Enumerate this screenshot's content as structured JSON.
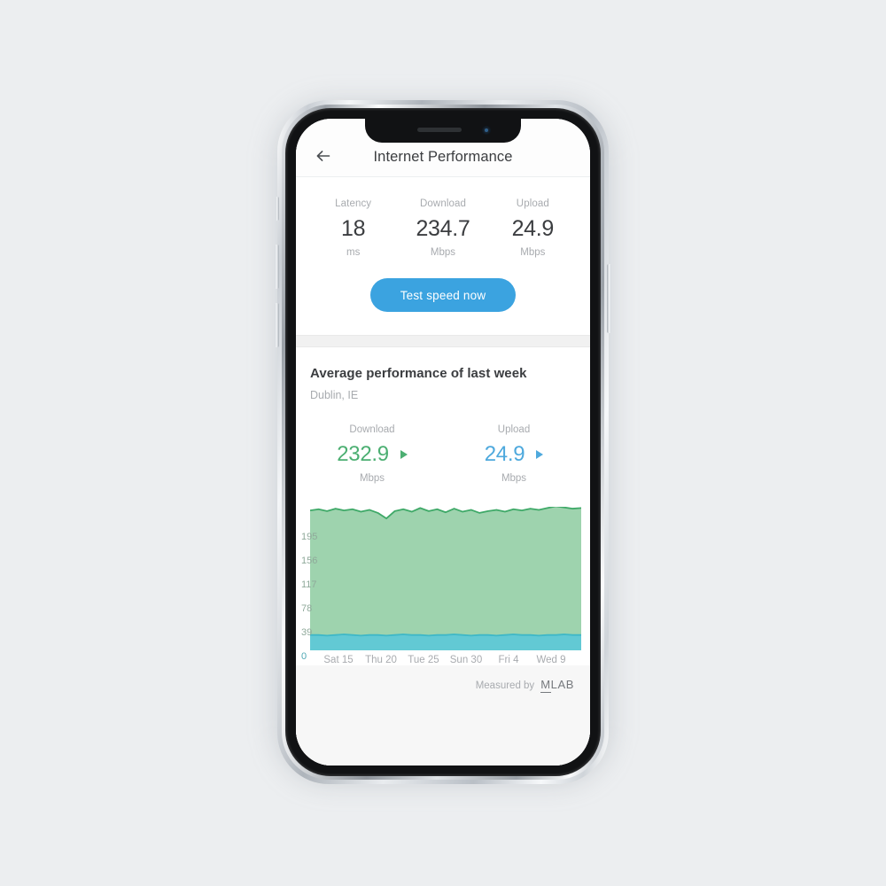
{
  "app": {
    "appbar": {
      "back_icon": "arrow-left-icon",
      "title": "Internet Performance"
    },
    "current_stats": [
      {
        "label": "Latency",
        "value": "18",
        "unit": "ms"
      },
      {
        "label": "Download",
        "value": "234.7",
        "unit": "Mbps"
      },
      {
        "label": "Upload",
        "value": "24.9",
        "unit": "Mbps"
      }
    ],
    "test_button": {
      "label": "Test speed now"
    },
    "average_section": {
      "title": "Average performance of last week",
      "location": "Dublin, IE",
      "stats": [
        {
          "label": "Download",
          "value": "232.9",
          "unit": "Mbps",
          "indicator": "triangle-right-icon",
          "color": "#4caf72"
        },
        {
          "label": "Upload",
          "value": "24.9",
          "unit": "Mbps",
          "indicator": "triangle-right-icon",
          "color": "#4ea9dd"
        }
      ]
    },
    "footer": {
      "measured_by": "Measured by",
      "provider_m": "M",
      "provider_rest": "LAB"
    }
  },
  "colors": {
    "accent_blue": "#3ba3e0",
    "download_green": "#4caf72",
    "upload_blue": "#4ea9dd",
    "area_green_fill": "#9ed3ae",
    "area_blue_fill": "#62c9d4",
    "text_dark": "#3b3d40",
    "text_muted": "#a8abaf"
  },
  "chart_data": {
    "type": "area",
    "title": "",
    "xlabel": "",
    "ylabel": "",
    "ylim": [
      0,
      234
    ],
    "yticks": [
      0,
      39,
      78,
      117,
      156,
      195
    ],
    "ytick_labels": [
      "0",
      "39",
      "78",
      "117",
      "156",
      "195"
    ],
    "grid": true,
    "legend": null,
    "categories": [
      "Sat 15",
      "Thu 20",
      "Tue 25",
      "Sun 30",
      "Fri 4",
      "Wed 9"
    ],
    "xtick_labels": [
      "Sat 15",
      "Thu 20",
      "Tue 25",
      "Sun 30",
      "Fri 4",
      "Wed 9"
    ],
    "series": [
      {
        "name": "Download",
        "color": "#3fa968",
        "fill": "#9ed3ae",
        "unit": "Mbps",
        "values": [
          228,
          230,
          227,
          231,
          228,
          230,
          226,
          229,
          224,
          215,
          227,
          230,
          226,
          232,
          227,
          230,
          225,
          231,
          226,
          229,
          224,
          227,
          229,
          226,
          230,
          228,
          231,
          229,
          232,
          235,
          233,
          231,
          232
        ]
      },
      {
        "name": "Upload",
        "color": "#3fb8c7",
        "fill": "#62c9d4",
        "unit": "Mbps",
        "values": [
          25,
          25,
          24,
          25,
          26,
          25,
          24,
          25,
          25,
          24,
          25,
          26,
          25,
          25,
          24,
          25,
          25,
          26,
          25,
          24,
          25,
          25,
          24,
          25,
          26,
          25,
          25,
          24,
          25,
          25,
          26,
          25,
          25
        ]
      }
    ]
  }
}
